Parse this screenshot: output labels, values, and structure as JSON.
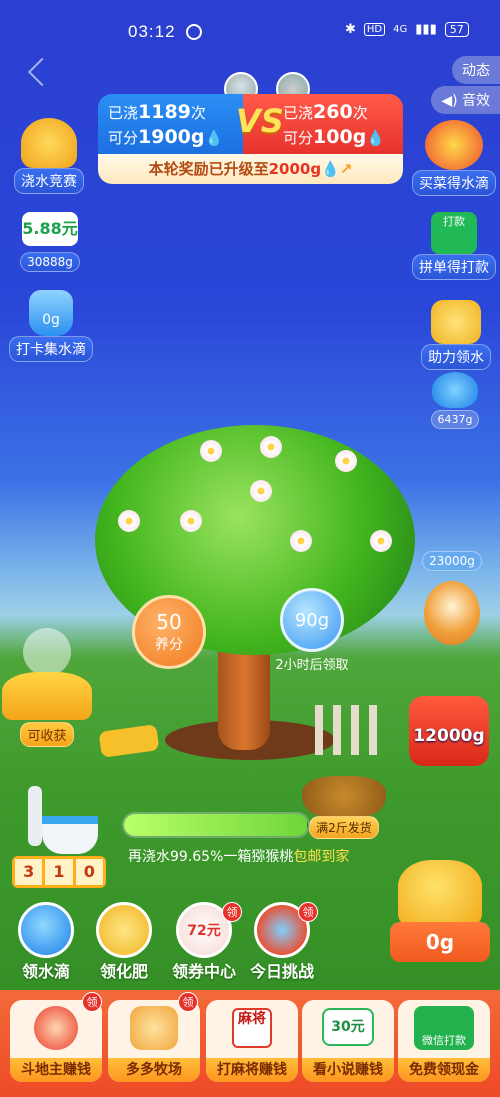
{
  "status": {
    "time": "03:12",
    "battery": "57",
    "net": "4G",
    "hd": "HD"
  },
  "top": {
    "dynamic": "动态",
    "sound": "音效"
  },
  "vs": {
    "left_watered_prefix": "已浇",
    "left_watered": "1189",
    "left_watered_suffix": "次",
    "left_score_prefix": "可分",
    "left_score": "1900g",
    "right_watered_prefix": "已浇",
    "right_watered": "260",
    "right_watered_suffix": "次",
    "right_score_prefix": "可分",
    "right_score": "100g",
    "vs_text": "VS",
    "banner_prefix": "本轮奖励已升级至",
    "banner_value": "2000g"
  },
  "left": {
    "contest": "浇水竞赛",
    "cash": "5.88元",
    "cash_grams": "30888g",
    "bottle": "0g",
    "checkin": "打卡集水滴"
  },
  "right": {
    "grocery": "买菜得水滴",
    "group": "拼单得打款",
    "help": "助力领水",
    "drops": "6437g",
    "dog_grams": "23000g",
    "gift": "12000g"
  },
  "tree": {
    "fertilizer_value": "50",
    "fertilizer_label": "养分",
    "bottle_value": "90g",
    "bottle_timer": "2小时后领取",
    "harvest": "可收获",
    "basket": "满2斤发货"
  },
  "progress": {
    "text_prefix": "再浇水99.65%一箱猕猴桃",
    "text_suffix": "包邮到家",
    "percent": 99.65,
    "counter": [
      "3",
      "1",
      "0"
    ]
  },
  "watering_can": {
    "value": "0g"
  },
  "actions": [
    {
      "label": "领水滴"
    },
    {
      "label": "领化肥"
    },
    {
      "label": "领券中心",
      "price": "72元",
      "badge": "领"
    },
    {
      "label": "今日挑战",
      "badge": "领"
    }
  ],
  "dock": [
    {
      "label": "斗地主赚钱",
      "badge": "领"
    },
    {
      "label": "多多牧场",
      "badge": "领"
    },
    {
      "label": "打麻将赚钱",
      "tile": "麻将"
    },
    {
      "label": "看小说赚钱",
      "tile": "30元"
    },
    {
      "label": "免费领现金",
      "tile": "微信打款"
    }
  ]
}
